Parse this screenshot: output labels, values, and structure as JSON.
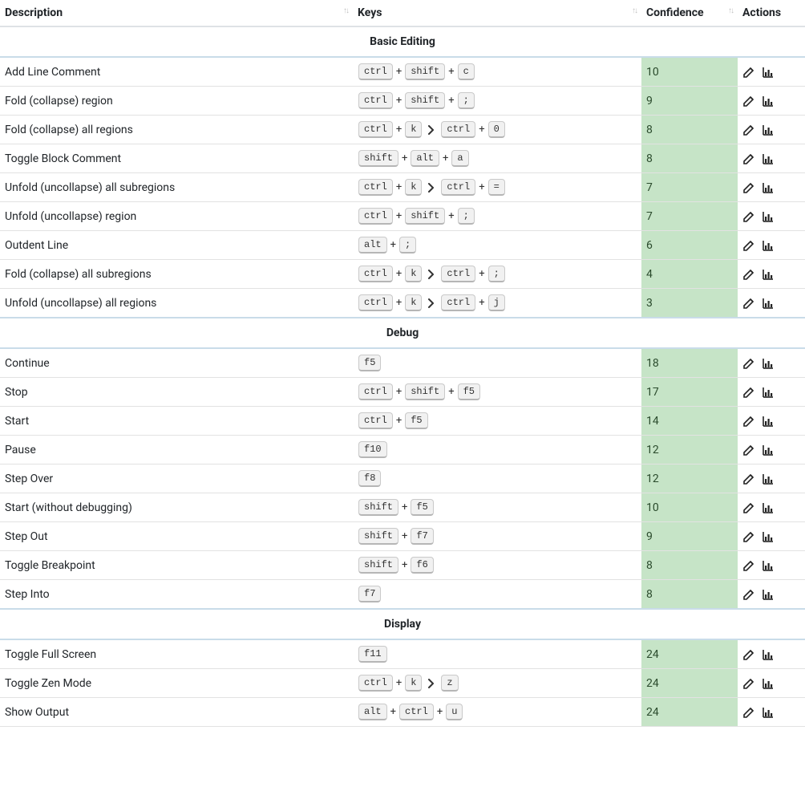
{
  "headers": {
    "description": "Description",
    "keys": "Keys",
    "confidence": "Confidence",
    "actions": "Actions"
  },
  "groups": [
    {
      "title": "Basic Editing",
      "rows": [
        {
          "description": "Add Line Comment",
          "keys": [
            [
              "ctrl",
              "shift",
              "c"
            ]
          ],
          "confidence": "10"
        },
        {
          "description": "Fold (collapse) region",
          "keys": [
            [
              "ctrl",
              "shift",
              ";"
            ]
          ],
          "confidence": "9"
        },
        {
          "description": "Fold (collapse) all regions",
          "keys": [
            [
              "ctrl",
              "k"
            ],
            [
              "ctrl",
              "0"
            ]
          ],
          "confidence": "8"
        },
        {
          "description": "Toggle Block Comment",
          "keys": [
            [
              "shift",
              "alt",
              "a"
            ]
          ],
          "confidence": "8"
        },
        {
          "description": "Unfold (uncollapse) all subregions",
          "keys": [
            [
              "ctrl",
              "k"
            ],
            [
              "ctrl",
              "="
            ]
          ],
          "confidence": "7"
        },
        {
          "description": "Unfold (uncollapse) region",
          "keys": [
            [
              "ctrl",
              "shift",
              ";"
            ]
          ],
          "confidence": "7"
        },
        {
          "description": "Outdent Line",
          "keys": [
            [
              "alt",
              ";"
            ]
          ],
          "confidence": "6"
        },
        {
          "description": "Fold (collapse) all subregions",
          "keys": [
            [
              "ctrl",
              "k"
            ],
            [
              "ctrl",
              ";"
            ]
          ],
          "confidence": "4"
        },
        {
          "description": "Unfold (uncollapse) all regions",
          "keys": [
            [
              "ctrl",
              "k"
            ],
            [
              "ctrl",
              "j"
            ]
          ],
          "confidence": "3"
        }
      ]
    },
    {
      "title": "Debug",
      "rows": [
        {
          "description": "Continue",
          "keys": [
            [
              "f5"
            ]
          ],
          "confidence": "18"
        },
        {
          "description": "Stop",
          "keys": [
            [
              "ctrl",
              "shift",
              "f5"
            ]
          ],
          "confidence": "17"
        },
        {
          "description": "Start",
          "keys": [
            [
              "ctrl",
              "f5"
            ]
          ],
          "confidence": "14"
        },
        {
          "description": "Pause",
          "keys": [
            [
              "f10"
            ]
          ],
          "confidence": "12"
        },
        {
          "description": "Step Over",
          "keys": [
            [
              "f8"
            ]
          ],
          "confidence": "12"
        },
        {
          "description": "Start (without debugging)",
          "keys": [
            [
              "shift",
              "f5"
            ]
          ],
          "confidence": "10"
        },
        {
          "description": "Step Out",
          "keys": [
            [
              "shift",
              "f7"
            ]
          ],
          "confidence": "9"
        },
        {
          "description": "Toggle Breakpoint",
          "keys": [
            [
              "shift",
              "f6"
            ]
          ],
          "confidence": "8"
        },
        {
          "description": "Step Into",
          "keys": [
            [
              "f7"
            ]
          ],
          "confidence": "8"
        }
      ]
    },
    {
      "title": "Display",
      "rows": [
        {
          "description": "Toggle Full Screen",
          "keys": [
            [
              "f11"
            ]
          ],
          "confidence": "24"
        },
        {
          "description": "Toggle Zen Mode",
          "keys": [
            [
              "ctrl",
              "k"
            ],
            [
              "z"
            ]
          ],
          "confidence": "24"
        },
        {
          "description": "Show Output",
          "keys": [
            [
              "alt",
              "ctrl",
              "u"
            ]
          ],
          "confidence": "24"
        }
      ]
    }
  ]
}
